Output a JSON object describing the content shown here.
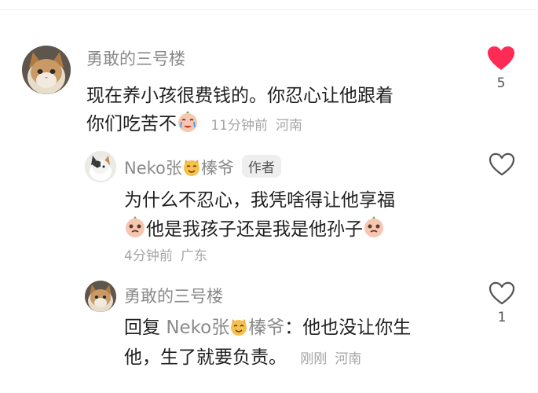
{
  "comments": [
    {
      "username": "勇敢的三号楼",
      "text_line1": "现在养小孩很费钱的。你忍心让他跟着",
      "text_line2": "你们吃苦不",
      "time": "11分钟前",
      "location": "河南",
      "likes": "5",
      "liked": true
    },
    {
      "username_prefix": "Neko张",
      "username_suffix": "榛爷",
      "badge": "作者",
      "text_line1": "为什么不忍心，我凭啥得让他享福",
      "text_line2": "他是我孩子还是我是他孙子",
      "time": "4分钟前",
      "location": "广东",
      "liked": false
    },
    {
      "username": "勇敢的三号楼",
      "reply_label": "回复",
      "mention_prefix": "Neko张",
      "mention_suffix": "榛爷",
      "text_line1": "：他也没让你生",
      "text_line2": "他，生了就要负责。",
      "time": "刚刚",
      "location": "河南",
      "likes": "1",
      "liked": false
    }
  ],
  "colors": {
    "like_active": "#fe2c55",
    "name_gray": "#8a8a8a",
    "meta_gray": "#a5a5a5"
  },
  "icons": [
    "heart-filled-icon",
    "heart-outline-icon",
    "crying-face-emoji",
    "pleading-face-emoji",
    "cat-face-emoji"
  ]
}
